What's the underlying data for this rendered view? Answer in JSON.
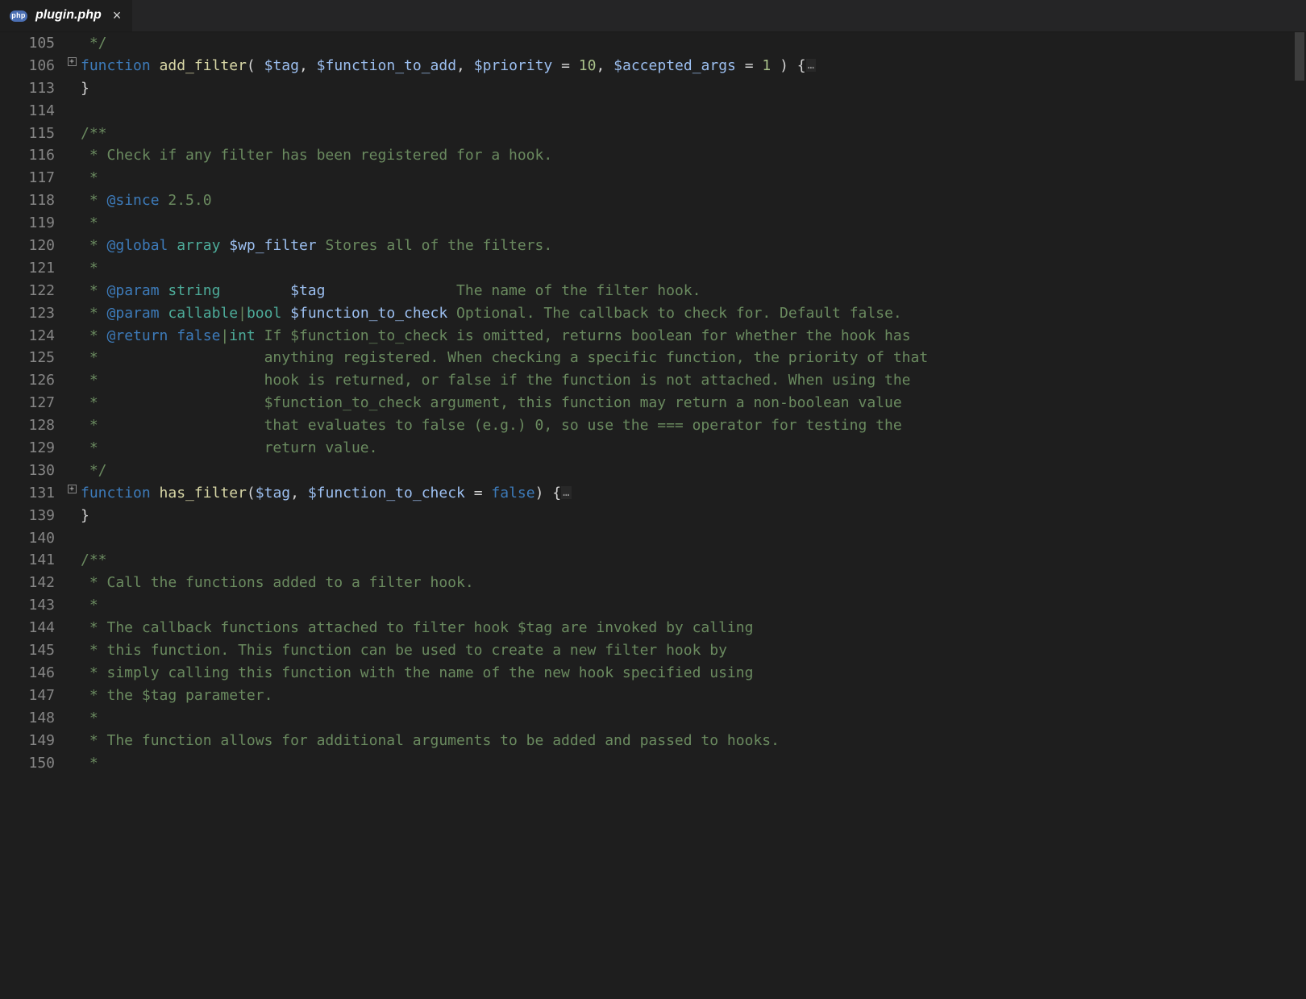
{
  "tab": {
    "file_icon_label": "php",
    "filename": "plugin.php",
    "close_glyph": "×"
  },
  "lines": [
    {
      "num": "105",
      "fold": "",
      "tokens": [
        [
          "punct",
          " "
        ],
        [
          "cmt",
          "*/"
        ]
      ]
    },
    {
      "num": "106",
      "fold": "plus",
      "tokens": [
        [
          "kw",
          "function"
        ],
        [
          "punct",
          " "
        ],
        [
          "fn",
          "add_filter"
        ],
        [
          "punct",
          "( "
        ],
        [
          "var",
          "$tag"
        ],
        [
          "punct",
          ", "
        ],
        [
          "var",
          "$function_to_add"
        ],
        [
          "punct",
          ", "
        ],
        [
          "var",
          "$priority"
        ],
        [
          "punct",
          " = "
        ],
        [
          "num",
          "10"
        ],
        [
          "punct",
          ", "
        ],
        [
          "var",
          "$accepted_args"
        ],
        [
          "punct",
          " = "
        ],
        [
          "num",
          "1"
        ],
        [
          "punct",
          " ) {"
        ],
        [
          "ell",
          "…"
        ]
      ]
    },
    {
      "num": "113",
      "fold": "",
      "tokens": [
        [
          "punct",
          "}"
        ]
      ]
    },
    {
      "num": "114",
      "fold": "",
      "tokens": [
        [
          "punct",
          ""
        ]
      ]
    },
    {
      "num": "115",
      "fold": "",
      "tokens": [
        [
          "cmt",
          "/**"
        ]
      ]
    },
    {
      "num": "116",
      "fold": "",
      "tokens": [
        [
          "cmt",
          " * Check if any filter has been registered for a hook."
        ]
      ]
    },
    {
      "num": "117",
      "fold": "",
      "tokens": [
        [
          "cmt",
          " *"
        ]
      ]
    },
    {
      "num": "118",
      "fold": "",
      "tokens": [
        [
          "cmt",
          " * "
        ],
        [
          "tag",
          "@since"
        ],
        [
          "cmt",
          " 2.5.0"
        ]
      ]
    },
    {
      "num": "119",
      "fold": "",
      "tokens": [
        [
          "cmt",
          " *"
        ]
      ]
    },
    {
      "num": "120",
      "fold": "",
      "tokens": [
        [
          "cmt",
          " * "
        ],
        [
          "tag",
          "@global"
        ],
        [
          "cmt",
          " "
        ],
        [
          "type",
          "array"
        ],
        [
          "cmt",
          " "
        ],
        [
          "var",
          "$wp_filter"
        ],
        [
          "cmt",
          " Stores all of the filters."
        ]
      ]
    },
    {
      "num": "121",
      "fold": "",
      "tokens": [
        [
          "cmt",
          " *"
        ]
      ]
    },
    {
      "num": "122",
      "fold": "",
      "tokens": [
        [
          "cmt",
          " * "
        ],
        [
          "tag",
          "@param"
        ],
        [
          "cmt",
          " "
        ],
        [
          "type",
          "string"
        ],
        [
          "cmt",
          "        "
        ],
        [
          "var",
          "$tag"
        ],
        [
          "cmt",
          "               The name of the filter hook."
        ]
      ]
    },
    {
      "num": "123",
      "fold": "",
      "tokens": [
        [
          "cmt",
          " * "
        ],
        [
          "tag",
          "@param"
        ],
        [
          "cmt",
          " "
        ],
        [
          "type",
          "callable"
        ],
        [
          "cmt",
          "|"
        ],
        [
          "type",
          "bool"
        ],
        [
          "cmt",
          " "
        ],
        [
          "var",
          "$function_to_check"
        ],
        [
          "cmt",
          " Optional. The callback to check for. Default false."
        ]
      ]
    },
    {
      "num": "124",
      "fold": "",
      "tokens": [
        [
          "cmt",
          " * "
        ],
        [
          "tag",
          "@return"
        ],
        [
          "cmt",
          " "
        ],
        [
          "typeb",
          "false"
        ],
        [
          "cmt",
          "|"
        ],
        [
          "type",
          "int"
        ],
        [
          "cmt",
          " If $function_to_check is omitted, returns boolean for whether the hook has"
        ]
      ]
    },
    {
      "num": "125",
      "fold": "",
      "tokens": [
        [
          "cmt",
          " *                   anything registered. When checking a specific function, the priority of that"
        ]
      ]
    },
    {
      "num": "126",
      "fold": "",
      "tokens": [
        [
          "cmt",
          " *                   hook is returned, or false if the function is not attached. When using the"
        ]
      ]
    },
    {
      "num": "127",
      "fold": "",
      "tokens": [
        [
          "cmt",
          " *                   $function_to_check argument, this function may return a non-boolean value"
        ]
      ]
    },
    {
      "num": "128",
      "fold": "",
      "tokens": [
        [
          "cmt",
          " *                   that evaluates to false (e.g.) 0, so use the === operator for testing the"
        ]
      ]
    },
    {
      "num": "129",
      "fold": "",
      "tokens": [
        [
          "cmt",
          " *                   return value."
        ]
      ]
    },
    {
      "num": "130",
      "fold": "",
      "tokens": [
        [
          "cmt",
          " */"
        ]
      ]
    },
    {
      "num": "131",
      "fold": "plus",
      "tokens": [
        [
          "kw",
          "function"
        ],
        [
          "punct",
          " "
        ],
        [
          "fn",
          "has_filter"
        ],
        [
          "punct",
          "("
        ],
        [
          "var",
          "$tag"
        ],
        [
          "punct",
          ", "
        ],
        [
          "var",
          "$function_to_check"
        ],
        [
          "punct",
          " = "
        ],
        [
          "const",
          "false"
        ],
        [
          "punct",
          ") {"
        ],
        [
          "ell",
          "…"
        ]
      ]
    },
    {
      "num": "139",
      "fold": "",
      "tokens": [
        [
          "punct",
          "}"
        ]
      ]
    },
    {
      "num": "140",
      "fold": "",
      "tokens": [
        [
          "punct",
          ""
        ]
      ]
    },
    {
      "num": "141",
      "fold": "",
      "tokens": [
        [
          "cmt",
          "/**"
        ]
      ]
    },
    {
      "num": "142",
      "fold": "",
      "tokens": [
        [
          "cmt",
          " * Call the functions added to a filter hook."
        ]
      ]
    },
    {
      "num": "143",
      "fold": "",
      "tokens": [
        [
          "cmt",
          " *"
        ]
      ]
    },
    {
      "num": "144",
      "fold": "",
      "tokens": [
        [
          "cmt",
          " * The callback functions attached to filter hook $tag are invoked by calling"
        ]
      ]
    },
    {
      "num": "145",
      "fold": "",
      "tokens": [
        [
          "cmt",
          " * this function. This function can be used to create a new filter hook by"
        ]
      ]
    },
    {
      "num": "146",
      "fold": "",
      "tokens": [
        [
          "cmt",
          " * simply calling this function with the name of the new hook specified using"
        ]
      ]
    },
    {
      "num": "147",
      "fold": "",
      "tokens": [
        [
          "cmt",
          " * the $tag parameter."
        ]
      ]
    },
    {
      "num": "148",
      "fold": "",
      "tokens": [
        [
          "cmt",
          " *"
        ]
      ]
    },
    {
      "num": "149",
      "fold": "",
      "tokens": [
        [
          "cmt",
          " * The function allows for additional arguments to be added and passed to hooks."
        ]
      ]
    },
    {
      "num": "150",
      "fold": "",
      "tokens": [
        [
          "cmt",
          " *"
        ]
      ]
    }
  ]
}
